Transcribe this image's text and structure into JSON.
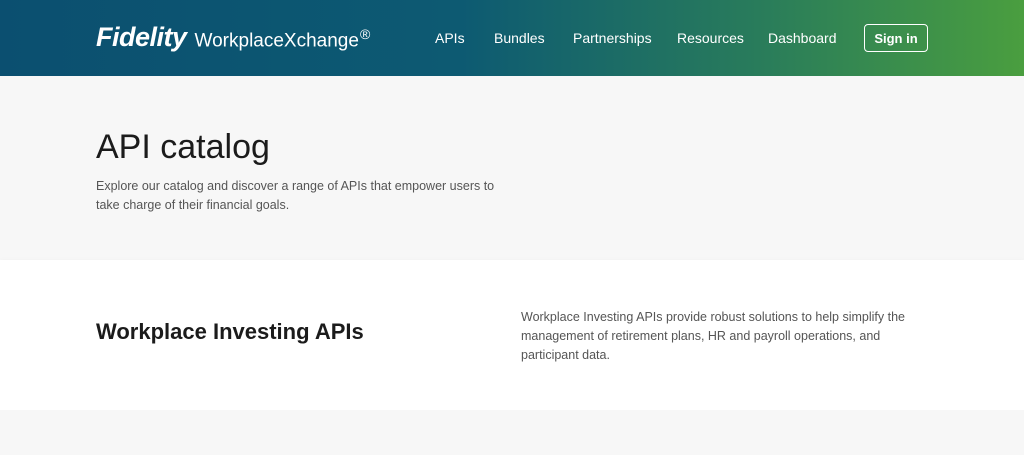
{
  "header": {
    "brand": "Fidelity",
    "product": "WorkplaceXchange",
    "registered": "®",
    "nav": [
      {
        "label": "APIs"
      },
      {
        "label": "Bundles"
      },
      {
        "label": "Partnerships"
      },
      {
        "label": "Resources"
      },
      {
        "label": "Dashboard"
      }
    ],
    "signin_label": "Sign in"
  },
  "hero": {
    "title": "API catalog",
    "description": "Explore our catalog and discover a range of APIs that empower users to take charge of their financial goals."
  },
  "section": {
    "title": "Workplace Investing APIs",
    "description": "Workplace Investing APIs provide robust solutions to help simplify the management of retirement plans, HR and payroll operations, and participant data."
  },
  "colors": {
    "header_start": "#0b4f70",
    "header_end": "#4a9e3f",
    "text_dark": "#1b1b1b",
    "text_muted": "#555555"
  }
}
